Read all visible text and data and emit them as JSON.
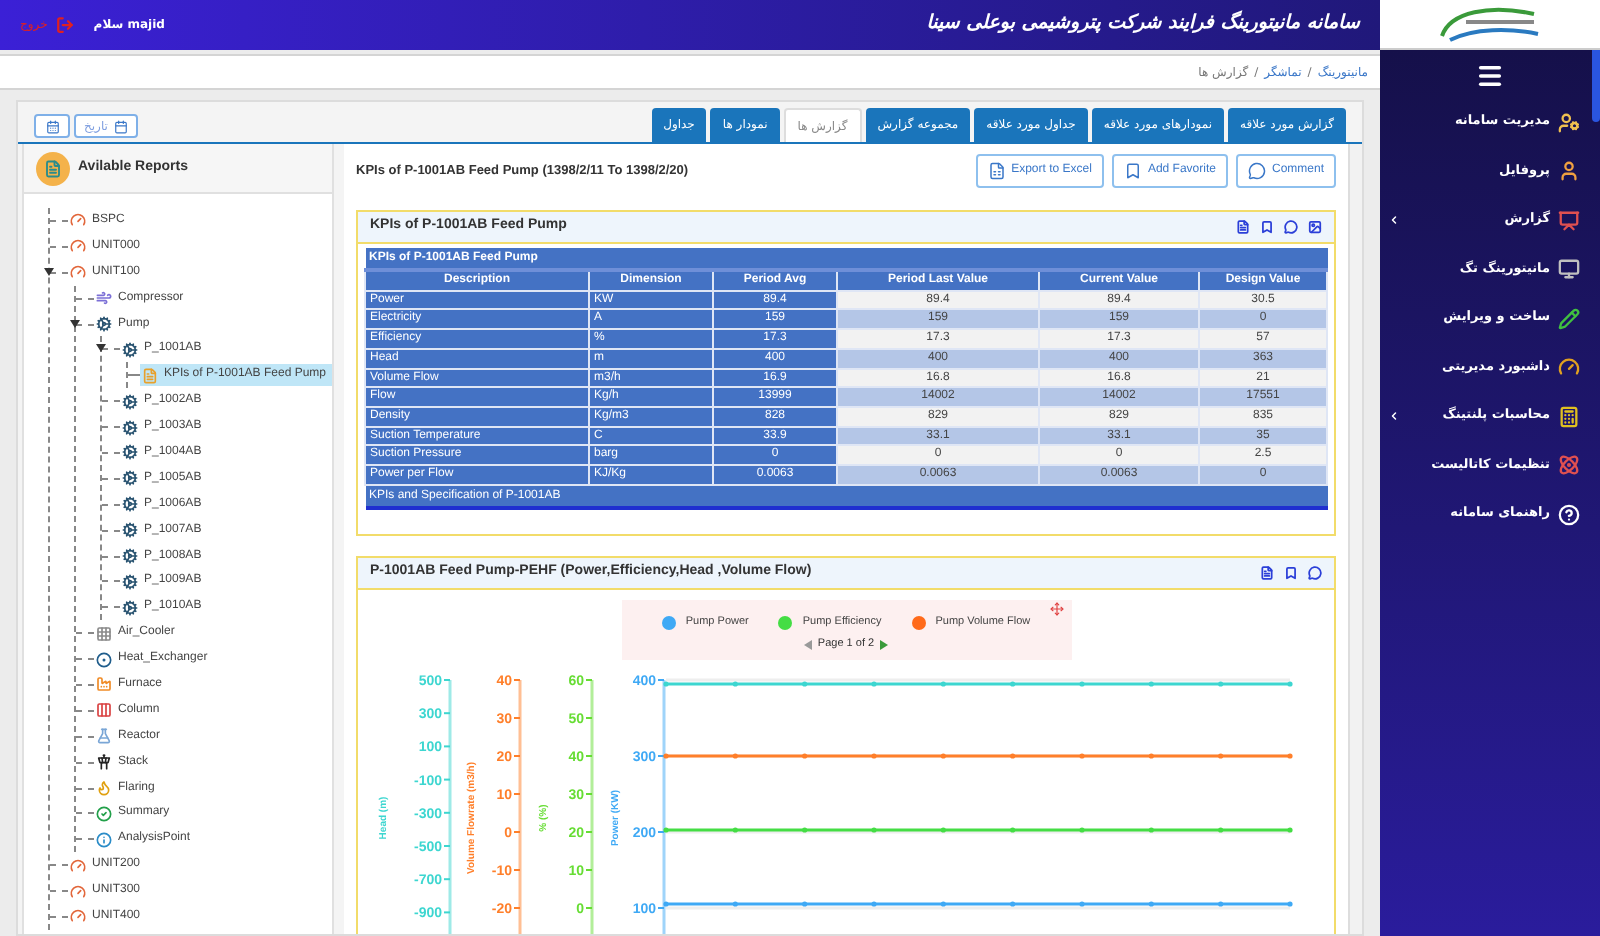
{
  "header": {
    "title": "سامانه مانیتورینگ فرایند شرکت پتروشیمی بوعلی سینا",
    "greeting": "سلام majid",
    "logout": "خروج"
  },
  "breadcrumbs": {
    "separator": "/",
    "items": [
      {
        "label": "مانیتورینگ",
        "current": false
      },
      {
        "label": "تماشگر",
        "current": false
      },
      {
        "label": "گزارش ها",
        "current": true
      }
    ]
  },
  "date_button": {
    "label": "تاریخ"
  },
  "tabs": [
    {
      "label": "گزارش مورد علاقه",
      "selected": false
    },
    {
      "label": "نمودارهای مورد علاقه",
      "selected": false
    },
    {
      "label": "جداول مورد علاقه",
      "selected": false
    },
    {
      "label": "مجموعه گزارش",
      "selected": false
    },
    {
      "label": "گزارش ها",
      "selected": true
    },
    {
      "label": "نمودار ها",
      "selected": false
    },
    {
      "label": "جداول",
      "selected": false
    }
  ],
  "tree": {
    "title": "Avilable Reports",
    "nodes": [
      {
        "label": "BSPC",
        "kind": "unit",
        "expanded": false,
        "selected": false
      },
      {
        "label": "UNIT000",
        "kind": "unit",
        "expanded": false,
        "selected": false
      },
      {
        "label": "UNIT100",
        "kind": "unit",
        "expanded": true,
        "selected": false,
        "children": [
          {
            "label": "Compressor",
            "kind": "compressor",
            "expanded": false,
            "selected": false
          },
          {
            "label": "Pump",
            "kind": "pump",
            "expanded": true,
            "selected": false,
            "children": [
              {
                "label": "P_1001AB",
                "kind": "pump",
                "expanded": true,
                "selected": false,
                "children": [
                  {
                    "label": "KPIs of P-1001AB Feed Pump",
                    "kind": "report",
                    "expanded": false,
                    "selected": true
                  }
                ]
              },
              {
                "label": "P_1002AB",
                "kind": "pump",
                "expanded": false,
                "selected": false
              },
              {
                "label": "P_1003AB",
                "kind": "pump",
                "expanded": false,
                "selected": false
              },
              {
                "label": "P_1004AB",
                "kind": "pump",
                "expanded": false,
                "selected": false
              },
              {
                "label": "P_1005AB",
                "kind": "pump",
                "expanded": false,
                "selected": false
              },
              {
                "label": "P_1006AB",
                "kind": "pump",
                "expanded": false,
                "selected": false
              },
              {
                "label": "P_1007AB",
                "kind": "pump",
                "expanded": false,
                "selected": false
              },
              {
                "label": "P_1008AB",
                "kind": "pump",
                "expanded": false,
                "selected": false
              },
              {
                "label": "P_1009AB",
                "kind": "pump",
                "expanded": false,
                "selected": false
              },
              {
                "label": "P_1010AB",
                "kind": "pump",
                "expanded": false,
                "selected": false
              }
            ]
          },
          {
            "label": "Air_Cooler",
            "kind": "air_cooler",
            "expanded": false,
            "selected": false
          },
          {
            "label": "Heat_Exchanger",
            "kind": "heat_exchanger",
            "expanded": false,
            "selected": false
          },
          {
            "label": "Furnace",
            "kind": "furnace",
            "expanded": false,
            "selected": false
          },
          {
            "label": "Column",
            "kind": "column",
            "expanded": false,
            "selected": false
          },
          {
            "label": "Reactor",
            "kind": "reactor",
            "expanded": false,
            "selected": false
          },
          {
            "label": "Stack",
            "kind": "stack",
            "expanded": false,
            "selected": false
          },
          {
            "label": "Flaring",
            "kind": "flaring",
            "expanded": false,
            "selected": false
          },
          {
            "label": "Summary",
            "kind": "summary",
            "expanded": false,
            "selected": false
          },
          {
            "label": "AnalysisPoint",
            "kind": "analysis",
            "expanded": false,
            "selected": false
          }
        ]
      },
      {
        "label": "UNIT200",
        "kind": "unit",
        "expanded": false,
        "selected": false
      },
      {
        "label": "UNIT300",
        "kind": "unit",
        "expanded": false,
        "selected": false
      },
      {
        "label": "UNIT400",
        "kind": "unit",
        "expanded": false,
        "selected": false
      }
    ]
  },
  "report": {
    "title": "KPIs of P-1001AB Feed Pump (1398/2/11 To 1398/2/20)",
    "actions": [
      "Export to Excel",
      "Add Favorite",
      "Comment"
    ]
  },
  "kpi_panel": {
    "title": "KPIs of P-1001AB Feed Pump",
    "table": {
      "caption": "KPIs of P-1001AB Feed Pump",
      "columns": [
        "Description",
        "Dimension",
        "Period Avg",
        "Period Last Value",
        "Current Value",
        "Design Value"
      ],
      "rows": [
        [
          "Power",
          "KW",
          "89.4",
          "89.4",
          "89.4",
          "30.5"
        ],
        [
          "Electricity",
          "A",
          "159",
          "159",
          "159",
          "0"
        ],
        [
          "Efficiency",
          "%",
          "17.3",
          "17.3",
          "17.3",
          "57"
        ],
        [
          "Head",
          "m",
          "400",
          "400",
          "400",
          "363"
        ],
        [
          "Volume Flow",
          "m3/h",
          "16.9",
          "16.8",
          "16.8",
          "21"
        ],
        [
          "Flow",
          "Kg/h",
          "13999",
          "14002",
          "14002",
          "17551"
        ],
        [
          "Density",
          "Kg/m3",
          "828",
          "829",
          "829",
          "835"
        ],
        [
          "Suction Temperature",
          "C",
          "33.9",
          "33.1",
          "33.1",
          "35"
        ],
        [
          "Suction Pressure",
          "barg",
          "0",
          "0",
          "0",
          "2.5"
        ],
        [
          "Power per Flow",
          "KJ/Kg",
          "0.0063",
          "0.0063",
          "0.0063",
          "0"
        ]
      ],
      "footer": "KPIs and Specification of P-1001AB"
    }
  },
  "chart_panel": {
    "title": "P-1001AB Feed Pump-PEHF (Power,Efficiency,Head ,Volume Flow)",
    "legend": {
      "items": [
        {
          "name": "Pump Power",
          "color": "#3fa9f5"
        },
        {
          "name": "Pump Efficiency",
          "color": "#44dd44"
        },
        {
          "name": "Pump Volume Flow",
          "color": "#ff6a1a"
        }
      ],
      "pager": "Page 1 of 2"
    },
    "plot": {
      "axes": [
        {
          "label": "Head (m)",
          "color": "#3dd6d0",
          "ticks": [
            "500",
            "300",
            "100",
            "-100",
            "-300",
            "-500",
            "-700",
            "-900"
          ]
        },
        {
          "label": "Volume Flowrate (m3/h)",
          "color": "#ff7f2a",
          "ticks": [
            "40",
            "30",
            "20",
            "10",
            "0",
            "-10",
            "-20"
          ]
        },
        {
          "label": "% (%)",
          "color": "#66dd33",
          "ticks": [
            "60",
            "50",
            "40",
            "30",
            "20",
            "10",
            "0"
          ]
        },
        {
          "label": "Power (KW)",
          "color": "#3fa9f5",
          "ticks": [
            "400",
            "300",
            "200",
            "100"
          ]
        }
      ]
    }
  },
  "sidebar": {
    "items": [
      {
        "label": "مدیریت سامانه",
        "has_submenu": false
      },
      {
        "label": "پروفایل",
        "has_submenu": false
      },
      {
        "label": "گزارش",
        "has_submenu": true
      },
      {
        "label": "مانیتورینگ تگ",
        "has_submenu": false
      },
      {
        "label": "ساخت و ویرایش",
        "has_submenu": false
      },
      {
        "label": "داشبورد مدیریتی",
        "has_submenu": false
      },
      {
        "label": "محاسبات پلنتینگ",
        "has_submenu": true
      },
      {
        "label": "تنظیمات کاتالیست",
        "has_submenu": false
      },
      {
        "label": "راهنمای سامانه",
        "has_submenu": false
      }
    ]
  }
}
